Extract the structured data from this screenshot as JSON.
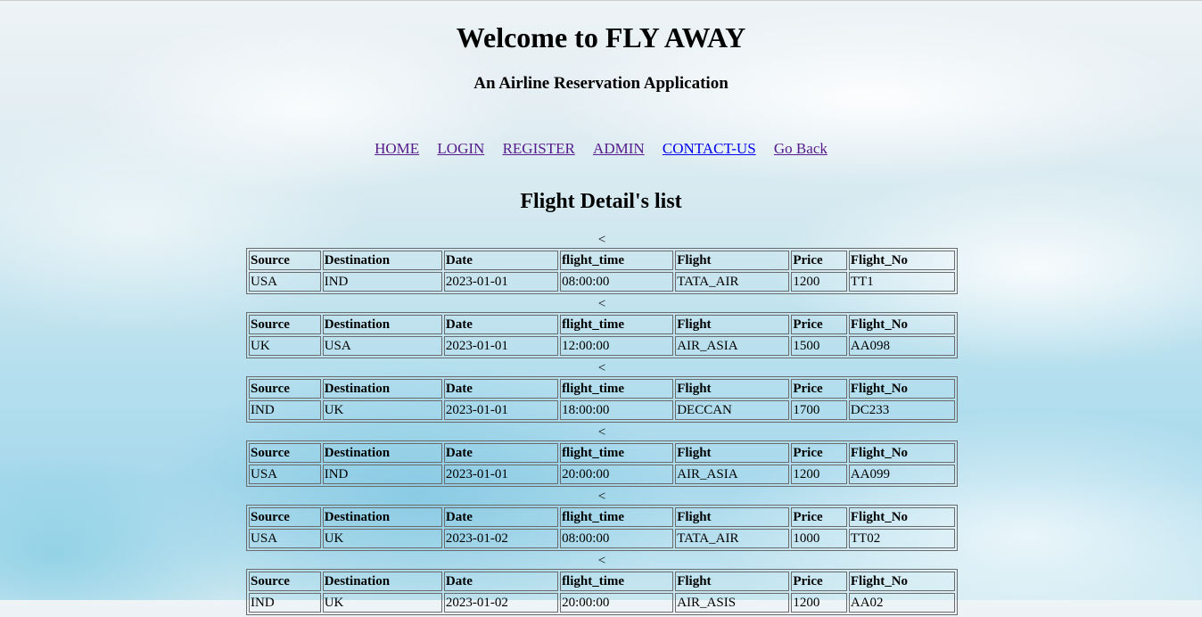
{
  "header": {
    "title": "Welcome to FLY AWAY",
    "subtitle": "An Airline Reservation Application"
  },
  "nav": {
    "items": [
      "HOME",
      "LOGIN",
      "REGISTER",
      "ADMIN",
      "CONTACT-US",
      "Go Back"
    ]
  },
  "main": {
    "heading": "Flight Detail's list",
    "separator": "<",
    "columns": [
      "Source",
      "Destination",
      "Date",
      "flight_time",
      "Flight",
      "Price",
      "Flight_No"
    ],
    "flights": [
      {
        "source": "USA",
        "destination": "IND",
        "date": "2023-01-01",
        "flight_time": "08:00:00",
        "flight": "TATA_AIR",
        "price": "1200",
        "flight_no": "TT1"
      },
      {
        "source": "UK",
        "destination": "USA",
        "date": "2023-01-01",
        "flight_time": "12:00:00",
        "flight": "AIR_ASIA",
        "price": "1500",
        "flight_no": "AA098"
      },
      {
        "source": "IND",
        "destination": "UK",
        "date": "2023-01-01",
        "flight_time": "18:00:00",
        "flight": "DECCAN",
        "price": "1700",
        "flight_no": "DC233"
      },
      {
        "source": "USA",
        "destination": "IND",
        "date": "2023-01-01",
        "flight_time": "20:00:00",
        "flight": "AIR_ASIA",
        "price": "1200",
        "flight_no": "AA099"
      },
      {
        "source": "USA",
        "destination": "UK",
        "date": "2023-01-02",
        "flight_time": "08:00:00",
        "flight": "TATA_AIR",
        "price": "1000",
        "flight_no": "TT02"
      },
      {
        "source": "IND",
        "destination": "UK",
        "date": "2023-01-02",
        "flight_time": "20:00:00",
        "flight": "AIR_ASIS",
        "price": "1200",
        "flight_no": "AA02"
      }
    ]
  }
}
